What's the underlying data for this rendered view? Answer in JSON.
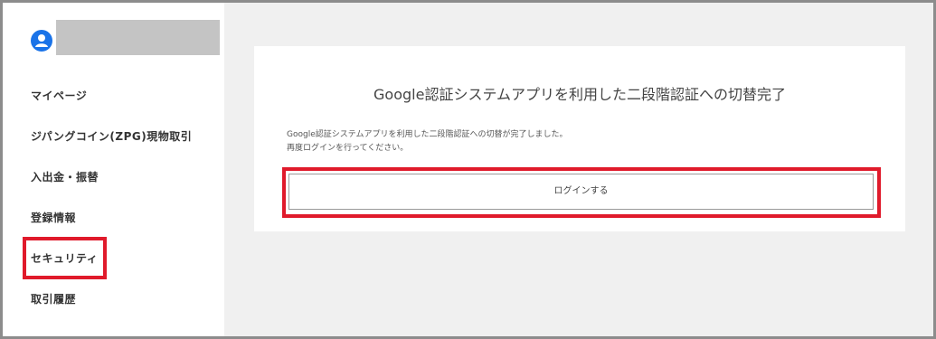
{
  "sidebar": {
    "items": [
      {
        "id": "mypage",
        "label": "マイページ"
      },
      {
        "id": "zpg-trade",
        "label": "ジパングコイン(ZPG)現物取引"
      },
      {
        "id": "deposit-withdraw",
        "label": "入出金・振替"
      },
      {
        "id": "registration",
        "label": "登録情報"
      },
      {
        "id": "security",
        "label": "セキュリティ"
      },
      {
        "id": "history",
        "label": "取引履歴"
      }
    ],
    "avatar_icon": "user-avatar-icon",
    "accent_color": "#1a73e8"
  },
  "main": {
    "title": "Google認証システムアプリを利用した二段階認証への切替完了",
    "message_line1": "Google認証システムアプリを利用した二段階認証への切替が完了しました。",
    "message_line2": "再度ログインを行ってください。",
    "login_button_label": "ログインする"
  },
  "highlight_color": "#e01a2b"
}
